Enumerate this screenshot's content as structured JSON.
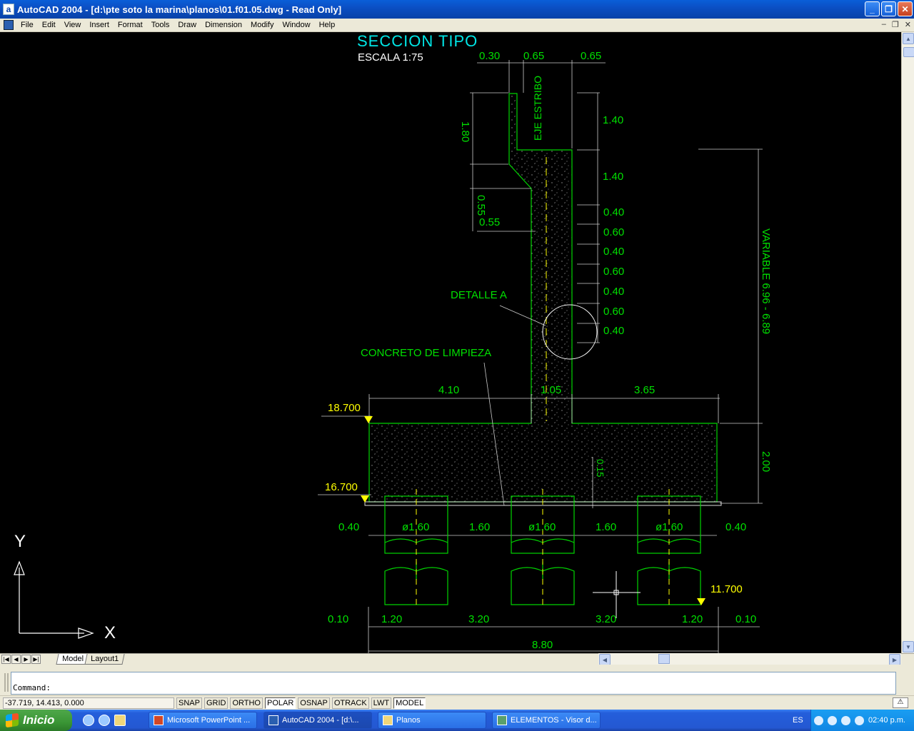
{
  "window": {
    "title": "AutoCAD 2004 - [d:\\pte soto la marina\\planos\\01.f01.05.dwg - Read Only]",
    "app_icon_letter": "a"
  },
  "menu": {
    "items": [
      "File",
      "Edit",
      "View",
      "Insert",
      "Format",
      "Tools",
      "Draw",
      "Dimension",
      "Modify",
      "Window",
      "Help"
    ]
  },
  "drawing": {
    "title": "SECCION  TIPO",
    "scale": "ESCALA 1:75",
    "top_dims": [
      "0.30",
      "0.65",
      "0.65"
    ],
    "left_vertical_dims": [
      "1.80",
      "0.55"
    ],
    "left_offset": "0.55",
    "axis_label": "EJE ESTRIBO",
    "right_stack_dims": [
      "1.40",
      "1.40",
      "0.40",
      "0.60",
      "0.40",
      "0.60",
      "0.40",
      "0.60",
      "0.40"
    ],
    "variable_label": "VARIABLE 6.96 - 6.89",
    "detail_label": "DETALLE A",
    "lean_concrete_label": "CONCRETO DE LIMPIEZA",
    "footing_dims": [
      "4.10",
      "1.05",
      "3.65"
    ],
    "footing_height": "2.00",
    "small_dim": "0.15",
    "elev_top": "18.700",
    "elev_bottom": "16.700",
    "elev_pile_tip": "11.700",
    "pile_row_dims": [
      "0.40",
      "ø1.60",
      "1.60",
      "ø1.60",
      "1.60",
      "ø1.60",
      "0.40"
    ],
    "bottom_row_dims": [
      "0.10",
      "1.20",
      "3.20",
      "3.20",
      "1.20",
      "0.10"
    ],
    "total_width": "8.80",
    "ucs_y": "Y",
    "ucs_x": "X",
    "colors": {
      "line": "#00d400",
      "dim_text": "#00e000",
      "title": "#00e6e6",
      "white_text": "#ffffff",
      "elevation": "#ffff00",
      "concrete": "#7f7f7f"
    }
  },
  "tabs": [
    "Model",
    "Layout1"
  ],
  "command": {
    "prompt": "Command:"
  },
  "status": {
    "coordinates": "-37.719, 14.413, 0.000",
    "toggles": [
      "SNAP",
      "GRID",
      "ORTHO",
      "POLAR",
      "OSNAP",
      "OTRACK",
      "LWT",
      "MODEL"
    ],
    "active_toggles": [
      "POLAR",
      "MODEL"
    ]
  },
  "taskbar": {
    "start_label": "Inicio",
    "tasks": [
      "Microsoft PowerPoint ...",
      "AutoCAD 2004 - [d:\\...",
      "Planos",
      "ELEMENTOS - Visor d..."
    ],
    "active_task": "AutoCAD 2004 - [d:\\...",
    "language": "ES",
    "clock": "02:40 p.m."
  }
}
